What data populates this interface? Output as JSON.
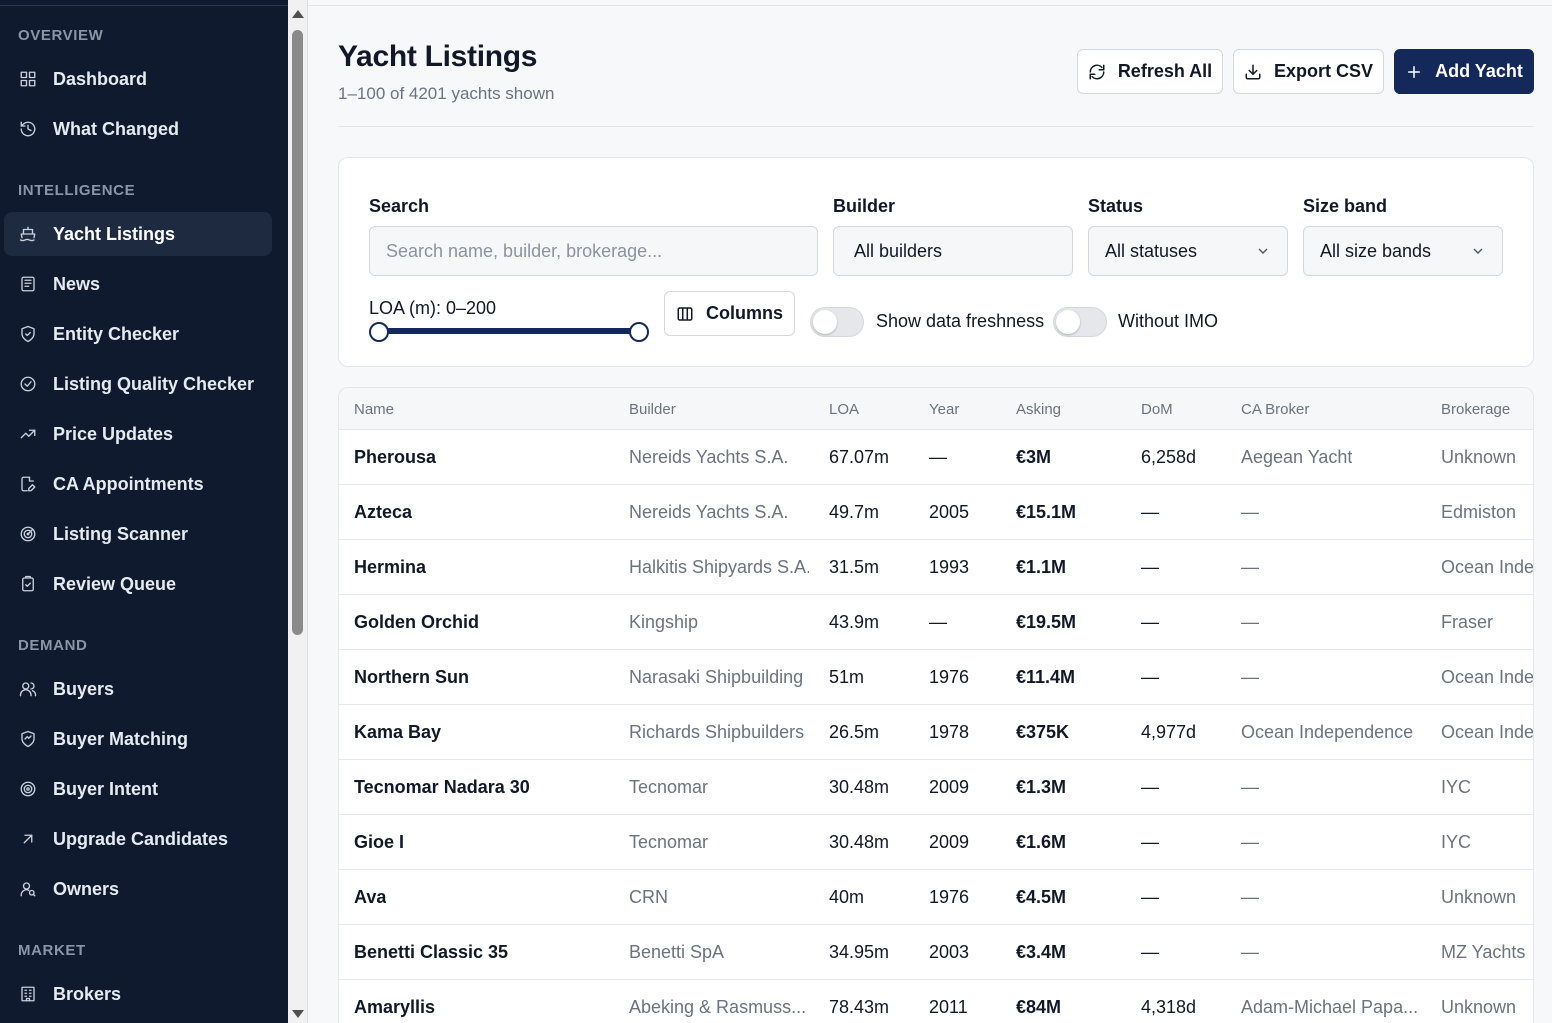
{
  "sidebar": {
    "groups": [
      {
        "label": "OVERVIEW",
        "items": [
          {
            "label": "Dashboard",
            "icon": "dashboard-icon"
          },
          {
            "label": "What Changed",
            "icon": "history-icon"
          }
        ]
      },
      {
        "label": "INTELLIGENCE",
        "items": [
          {
            "label": "Yacht Listings",
            "icon": "ship-icon",
            "active": true
          },
          {
            "label": "News",
            "icon": "newspaper-icon"
          },
          {
            "label": "Entity Checker",
            "icon": "shield-check-icon"
          },
          {
            "label": "Listing Quality Checker",
            "icon": "check-circle-icon"
          },
          {
            "label": "Price Updates",
            "icon": "trending-up-icon"
          },
          {
            "label": "CA Appointments",
            "icon": "file-edit-icon"
          },
          {
            "label": "Listing Scanner",
            "icon": "radar-icon"
          },
          {
            "label": "Review Queue",
            "icon": "clipboard-check-icon"
          }
        ]
      },
      {
        "label": "DEMAND",
        "items": [
          {
            "label": "Buyers",
            "icon": "users-icon"
          },
          {
            "label": "Buyer Matching",
            "icon": "handshake-icon"
          },
          {
            "label": "Buyer Intent",
            "icon": "target-icon"
          },
          {
            "label": "Upgrade Candidates",
            "icon": "arrow-up-right-icon"
          },
          {
            "label": "Owners",
            "icon": "user-search-icon"
          }
        ]
      },
      {
        "label": "MARKET",
        "items": [
          {
            "label": "Brokers",
            "icon": "building-icon"
          }
        ]
      }
    ]
  },
  "header": {
    "title": "Yacht Listings",
    "subtitle": "1–100 of 4201 yachts shown",
    "refresh_label": "Refresh All",
    "export_label": "Export CSV",
    "add_label": "Add Yacht"
  },
  "filters": {
    "search_label": "Search",
    "search_placeholder": "Search name, builder, brokerage...",
    "builder_label": "Builder",
    "builder_value": "All builders",
    "status_label": "Status",
    "status_value": "All statuses",
    "size_label": "Size band",
    "size_value": "All size bands",
    "loa_label": "LOA (m): 0–200",
    "loa_min": 0,
    "loa_max": 200,
    "columns_label": "Columns",
    "freshness_label": "Show data freshness",
    "freshness_on": false,
    "imo_label": "Without IMO",
    "imo_on": false
  },
  "table": {
    "columns": [
      "Name",
      "Builder",
      "LOA",
      "Year",
      "Asking",
      "DoM",
      "CA Broker",
      "Brokerage"
    ],
    "rows": [
      {
        "name": "Pherousa",
        "builder": "Nereids Yachts S.A.",
        "loa": "67.07m",
        "year": "—",
        "asking": "€3M",
        "dom": "6,258d",
        "broker": "Aegean Yacht",
        "brokerage": "Unknown"
      },
      {
        "name": "Azteca",
        "builder": "Nereids Yachts S.A.",
        "loa": "49.7m",
        "year": "2005",
        "asking": "€15.1M",
        "dom": "—",
        "broker": "—",
        "brokerage": "Edmiston"
      },
      {
        "name": "Hermina",
        "builder": "Halkitis Shipyards S.A.",
        "loa": "31.5m",
        "year": "1993",
        "asking": "€1.1M",
        "dom": "—",
        "broker": "—",
        "brokerage": "Ocean Independence"
      },
      {
        "name": "Golden Orchid",
        "builder": "Kingship",
        "loa": "43.9m",
        "year": "—",
        "asking": "€19.5M",
        "dom": "—",
        "broker": "—",
        "brokerage": "Fraser"
      },
      {
        "name": "Northern Sun",
        "builder": "Narasaki Shipbuilding",
        "loa": "51m",
        "year": "1976",
        "asking": "€11.4M",
        "dom": "—",
        "broker": "—",
        "brokerage": "Ocean Independence"
      },
      {
        "name": "Kama Bay",
        "builder": "Richards Shipbuilders",
        "loa": "26.5m",
        "year": "1978",
        "asking": "€375K",
        "dom": "4,977d",
        "broker": "Ocean Independence",
        "brokerage": "Ocean Independence"
      },
      {
        "name": "Tecnomar Nadara 30",
        "builder": "Tecnomar",
        "loa": "30.48m",
        "year": "2009",
        "asking": "€1.3M",
        "dom": "—",
        "broker": "—",
        "brokerage": "IYC"
      },
      {
        "name": "Gioe I",
        "builder": "Tecnomar",
        "loa": "30.48m",
        "year": "2009",
        "asking": "€1.6M",
        "dom": "—",
        "broker": "—",
        "brokerage": "IYC"
      },
      {
        "name": "Ava",
        "builder": "CRN",
        "loa": "40m",
        "year": "1976",
        "asking": "€4.5M",
        "dom": "—",
        "broker": "—",
        "brokerage": "Unknown"
      },
      {
        "name": "Benetti Classic 35",
        "builder": "Benetti SpA",
        "loa": "34.95m",
        "year": "2003",
        "asking": "€3.4M",
        "dom": "—",
        "broker": "—",
        "brokerage": "MZ Yachts"
      },
      {
        "name": "Amaryllis",
        "builder": "Abeking & Rasmuss...",
        "loa": "78.43m",
        "year": "2011",
        "asking": "€84M",
        "dom": "4,318d",
        "broker": "Adam-Michael Papa...",
        "brokerage": "Unknown"
      }
    ]
  }
}
